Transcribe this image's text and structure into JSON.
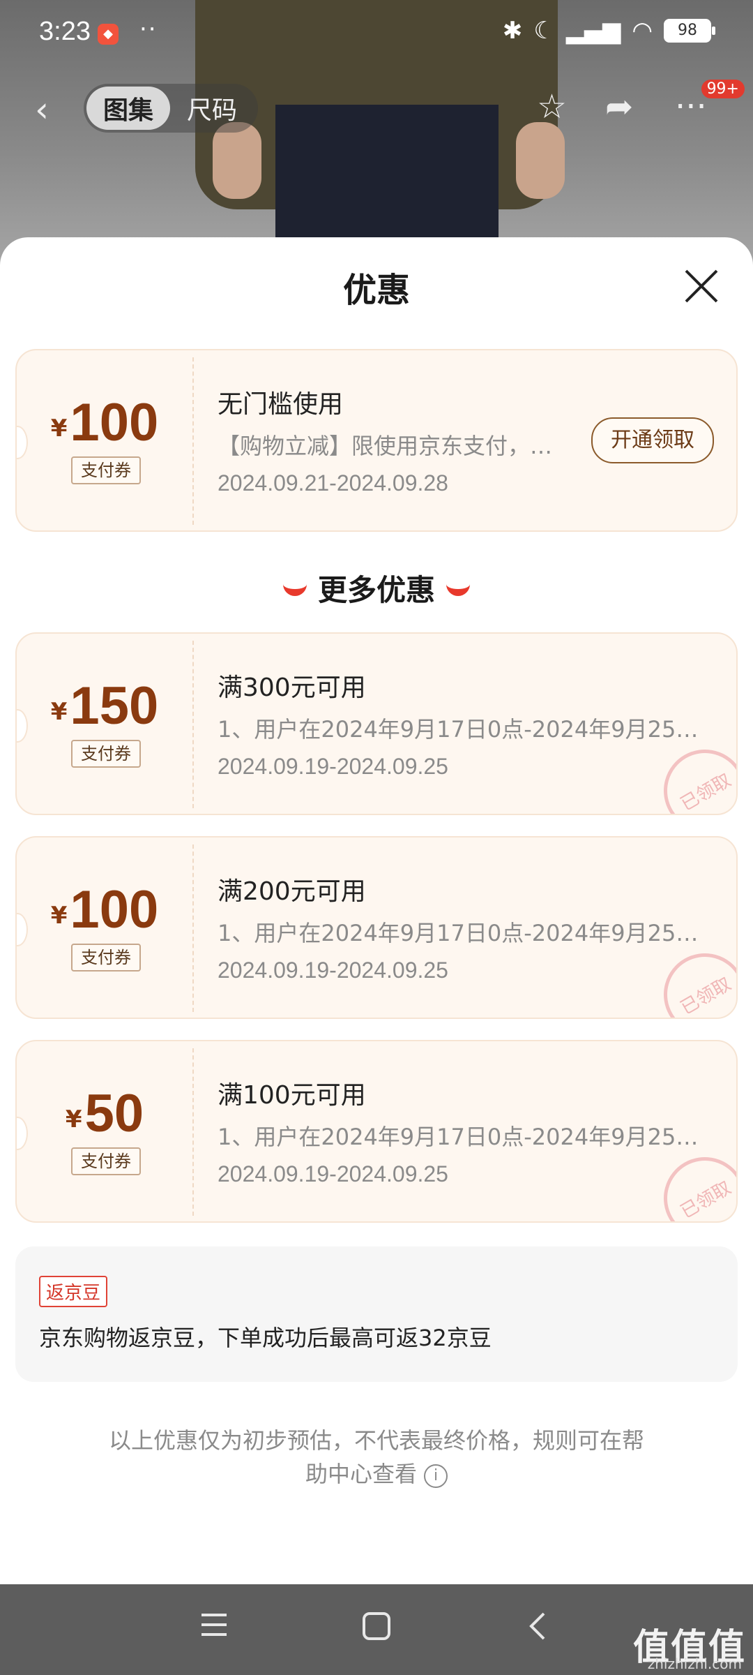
{
  "status_bar": {
    "time": "3:23",
    "battery": "98"
  },
  "top_nav": {
    "tab_active": "图集",
    "tab_inactive": "尺码",
    "badge": "99+"
  },
  "sheet": {
    "title": "优惠"
  },
  "primary_coupon": {
    "currency": "¥",
    "amount": "100",
    "tag": "支付券",
    "title": "无门槛使用",
    "desc": "【购物立减】限使用京东支付，…",
    "date": "2024.09.21-2024.09.28",
    "button": "开通领取"
  },
  "more_section": {
    "title": "更多优惠"
  },
  "coupons": [
    {
      "currency": "¥",
      "amount": "150",
      "tag": "支付券",
      "title": "满300元可用",
      "desc": "1、用户在2024年9月17日0点-2024年9月25日…",
      "date": "2024.09.19-2024.09.25",
      "stamp": "已领取"
    },
    {
      "currency": "¥",
      "amount": "100",
      "tag": "支付券",
      "title": "满200元可用",
      "desc": "1、用户在2024年9月17日0点-2024年9月25日…",
      "date": "2024.09.19-2024.09.25",
      "stamp": "已领取"
    },
    {
      "currency": "¥",
      "amount": "50",
      "tag": "支付券",
      "title": "满100元可用",
      "desc": "1、用户在2024年9月17日0点-2024年9月25日…",
      "date": "2024.09.19-2024.09.25",
      "stamp": "已领取"
    }
  ],
  "rebate": {
    "tag": "返京豆",
    "text": "京东购物返京豆，下单成功后最高可返32京豆"
  },
  "footer_note": {
    "line1": "以上优惠仅为初步预估，不代表最终价格，规则可在帮",
    "line2": "助中心查看"
  },
  "watermark": {
    "main": "值值值",
    "sub": "zhizhizhi.com"
  }
}
